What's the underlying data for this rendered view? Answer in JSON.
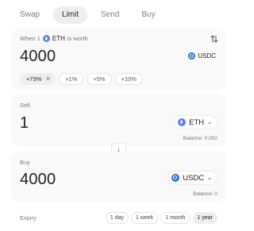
{
  "tabs": [
    {
      "label": "Swap",
      "active": false
    },
    {
      "label": "Limit",
      "active": true
    },
    {
      "label": "Send",
      "active": false
    },
    {
      "label": "Buy",
      "active": false
    }
  ],
  "limit": {
    "when_prefix": "When 1",
    "token": "ETH",
    "is_worth": "is worth",
    "price": "4000",
    "price_token": "USDC",
    "chips": [
      "+73%",
      "+1%",
      "+5%",
      "+10%"
    ],
    "selected_chip": "+73%"
  },
  "sell": {
    "label": "Sell",
    "amount": "1",
    "token": "ETH",
    "balance": "Balance: 0.002"
  },
  "buy": {
    "label": "Buy",
    "amount": "4000",
    "token": "USDC",
    "balance": "Balance: 0"
  },
  "expiry": {
    "label": "Expiry",
    "options": [
      "1 day",
      "1 week",
      "1 month",
      "1 year"
    ],
    "selected": "1 year"
  },
  "icons": {
    "eth": "eth-icon",
    "usdc": "usdc-icon",
    "switch": "arrows-up-down-icon",
    "down_arrow": "arrow-down-icon",
    "clear": "close-icon",
    "dropdown": "chevron-down-icon"
  },
  "colors": {
    "eth": "#627eea",
    "usdc": "#2775ca",
    "card_bg": "#f9f9f9",
    "active_tab_bg": "#eeeeee"
  }
}
